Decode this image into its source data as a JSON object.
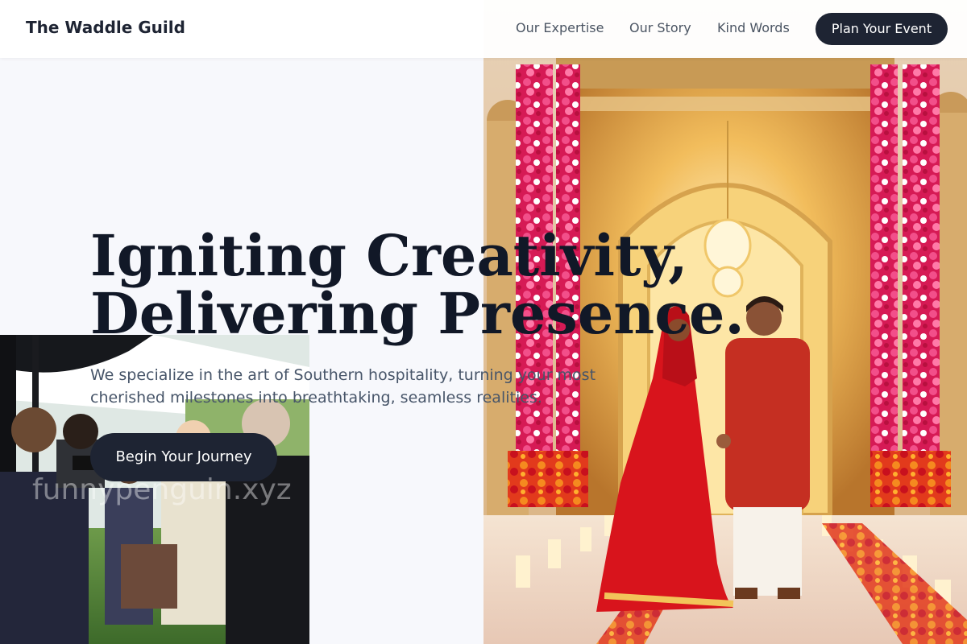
{
  "nav": {
    "brand": "The Waddle Guild",
    "links": [
      "Our Expertise",
      "Our Story",
      "Kind Words"
    ],
    "cta": "Plan Your Event"
  },
  "hero": {
    "title_line1": "Igniting Creativity,",
    "title_line2": "Delivering Presence.",
    "subtitle": "We specialize in the art of Southern hospitality, turning your most cherished milestones into breathtaking, seamless realities.",
    "button": "Begin Your Journey"
  },
  "watermark": "funnypenguin.xyz",
  "images": {
    "right": "wedding-couple-floral-arch-photo",
    "left": "outdoor-event-crowd-photographers-photo"
  },
  "colors": {
    "accent": "#1e2433",
    "page_bg": "#f7f8fc",
    "text_muted": "#475569"
  }
}
